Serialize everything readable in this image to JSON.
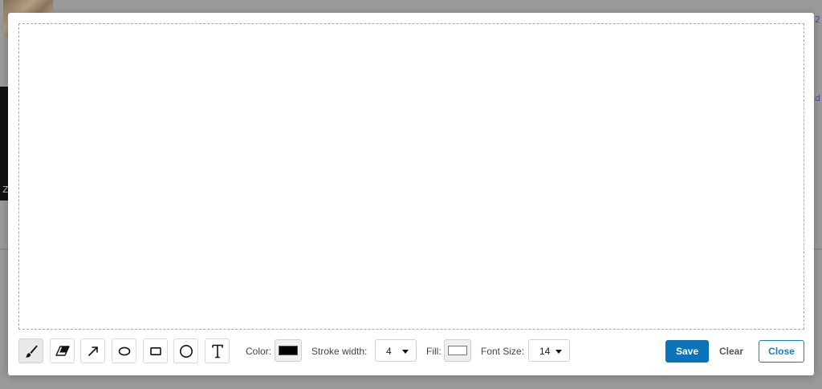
{
  "background": {
    "link_top": "2",
    "link_mid": "d",
    "dark_letter": "Z"
  },
  "toolbar": {
    "tools": [
      {
        "name": "brush",
        "icon": "brush-icon",
        "active": true
      },
      {
        "name": "eraser",
        "icon": "eraser-icon",
        "active": false
      },
      {
        "name": "arrow",
        "icon": "arrow-icon",
        "active": false
      },
      {
        "name": "ellipse",
        "icon": "ellipse-icon",
        "active": false
      },
      {
        "name": "rectangle",
        "icon": "rectangle-icon",
        "active": false
      },
      {
        "name": "circle",
        "icon": "circle-icon",
        "active": false
      },
      {
        "name": "text",
        "icon": "text-icon",
        "active": false
      }
    ],
    "color_label": "Color:",
    "color_value": "#000000",
    "stroke_label": "Stroke width:",
    "stroke_value": "4",
    "fill_label": "Fill:",
    "fill_value": "#ffffff",
    "font_size_label": "Font Size:",
    "font_size_value": "14",
    "save_label": "Save",
    "clear_label": "Clear",
    "close_label": "Close"
  },
  "colors": {
    "accent": "#0b74b8",
    "overlay": "#8d8d8d"
  }
}
